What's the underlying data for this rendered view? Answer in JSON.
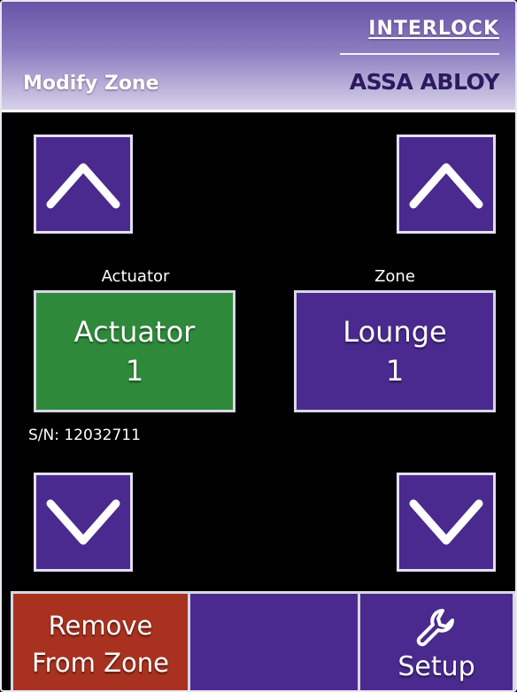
{
  "header": {
    "title": "Modify Zone",
    "brand_top": "INTERLOCK",
    "brand_bottom": "ASSA ABLOY"
  },
  "actuator": {
    "label": "Actuator",
    "name": "Actuator",
    "number": "1",
    "serial": "S/N: 12032711",
    "up_icon": "chevron-up-icon",
    "down_icon": "chevron-down-icon"
  },
  "zone": {
    "label": "Zone",
    "name": "Lounge",
    "number": "1",
    "up_icon": "chevron-up-icon",
    "down_icon": "chevron-down-icon"
  },
  "bottom_bar": {
    "remove_line1": "Remove",
    "remove_line2": "From Zone",
    "setup_label": "Setup",
    "setup_icon": "wrench-icon"
  },
  "colors": {
    "accent_purple": "#4a2a8e",
    "actuator_green": "#2e8a3a",
    "remove_red": "#a8321f"
  }
}
